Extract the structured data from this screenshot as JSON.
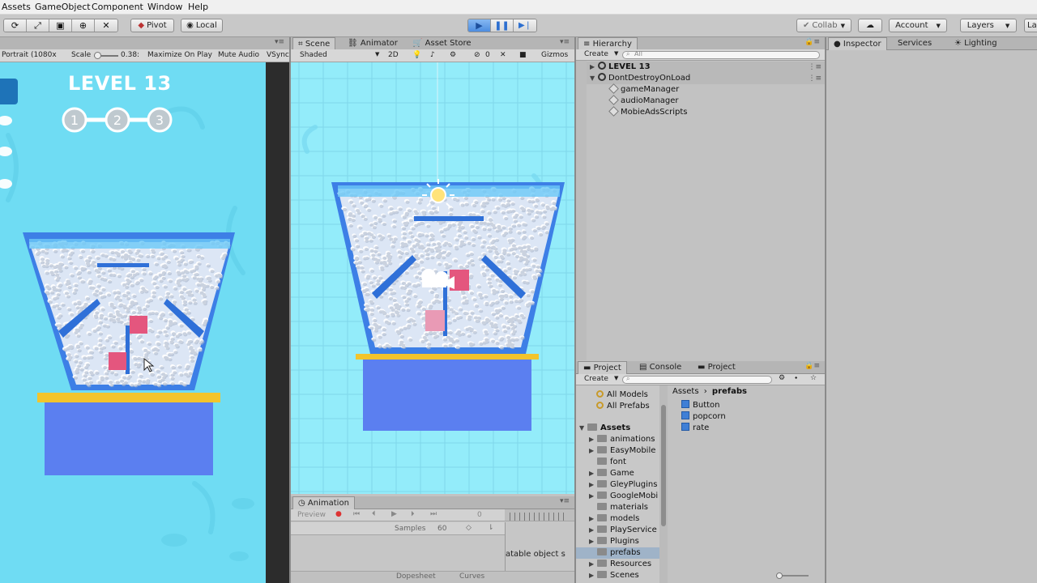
{
  "menu": [
    "Assets",
    "GameObject",
    "Component",
    "Window",
    "Help"
  ],
  "toolbar": {
    "pivot": "Pivot",
    "local": "Local",
    "collab": "Collab",
    "account": "Account",
    "layers": "Layers",
    "layout": "La"
  },
  "game_view": {
    "toolbar": {
      "resolution": "Portrait (1080x",
      "scale_label": "Scale",
      "scale_value": "0.38:",
      "maximize": "Maximize On Play",
      "mute": "Mute Audio",
      "vsync": "VSync"
    },
    "level_title": "LEVEL 13",
    "steps": [
      "1",
      "2",
      "3"
    ]
  },
  "scene_tabs": [
    "Scene",
    "Animator",
    "Asset Store"
  ],
  "scene_toolbar": {
    "shading": "Shaded",
    "mode_2d": "2D",
    "hidden_count": "0",
    "gizmos": "Gizmos"
  },
  "hierarchy": {
    "tab": "Hierarchy",
    "create": "Create",
    "search_placeholder": "All",
    "items": [
      {
        "label": "LEVEL 13",
        "bold": true,
        "indent": 0
      },
      {
        "label": "DontDestroyOnLoad",
        "bold": false,
        "indent": 0
      },
      {
        "label": "gameManager",
        "indent": 1
      },
      {
        "label": "audioManager",
        "indent": 1
      },
      {
        "label": "MobieAdsScripts",
        "indent": 1
      }
    ]
  },
  "inspector_tabs": [
    "Inspector",
    "Services",
    "Lighting"
  ],
  "project": {
    "tabs": [
      "Project",
      "Console",
      "Project"
    ],
    "create": "Create",
    "favorites": [
      "All Models",
      "All Prefabs"
    ],
    "assets_root": "Assets",
    "folders": [
      "animations",
      "EasyMobile",
      "font",
      "Game",
      "GleyPlugins",
      "GoogleMobi",
      "materials",
      "models",
      "PlayService",
      "Plugins",
      "prefabs",
      "Resources",
      "Scenes"
    ],
    "breadcrumb": [
      "Assets",
      "prefabs"
    ],
    "files": [
      "Button",
      "popcorn",
      "rate"
    ]
  },
  "animation": {
    "tab": "Animation",
    "preview": "Preview",
    "frame": "0",
    "samples_label": "Samples",
    "samples_value": "60",
    "message": "atable object s",
    "bottom_tabs": [
      "Dopesheet",
      "Curves"
    ]
  }
}
